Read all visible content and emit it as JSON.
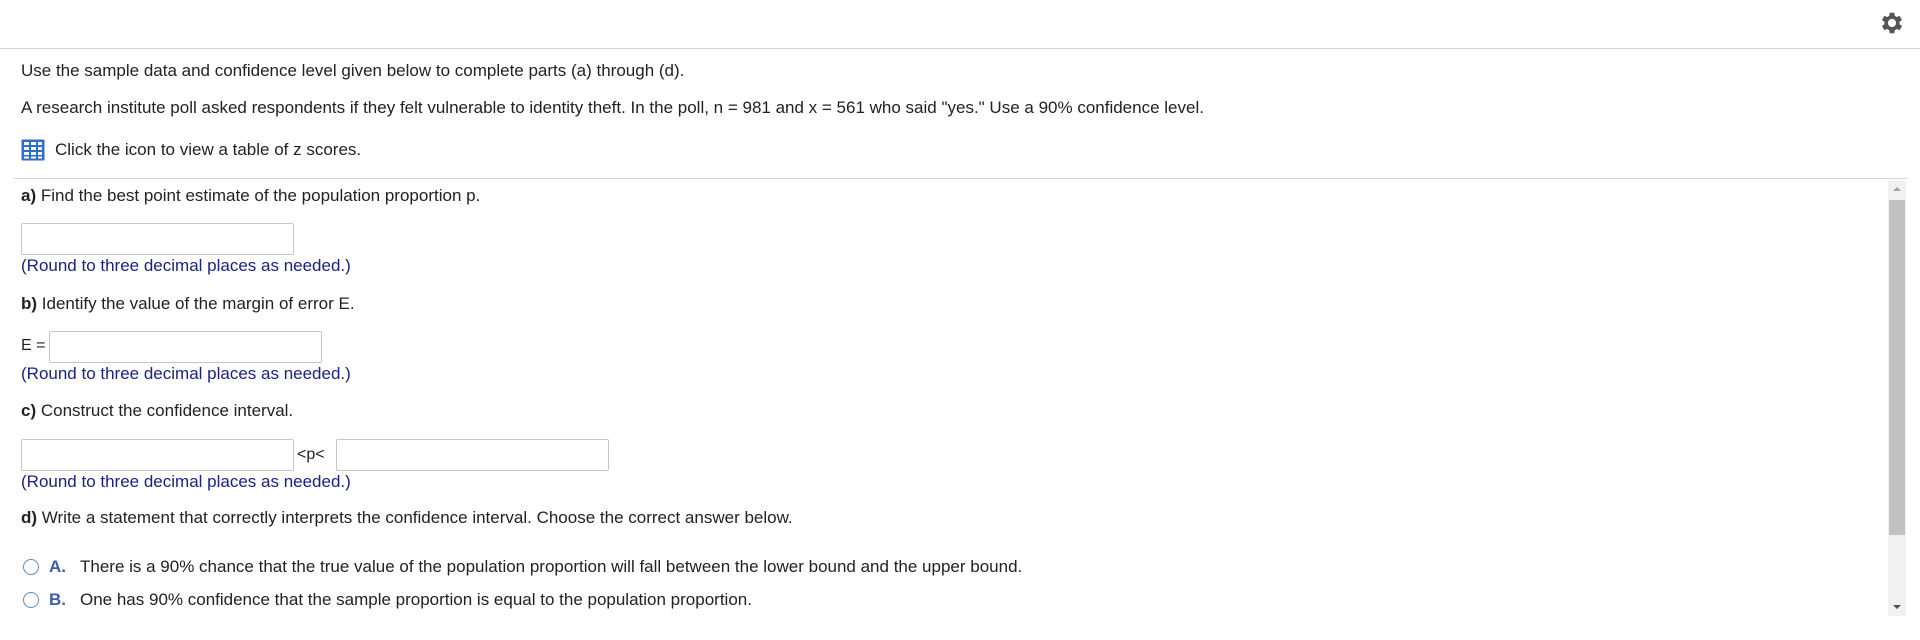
{
  "header": {
    "settings_icon": "gear-icon"
  },
  "intro": {
    "instruction": "Use the sample data and confidence level given below to complete parts (a) through (d).",
    "problem": "A research institute poll asked respondents if they felt vulnerable to identity theft. In the poll, n = 981 and x = 561 who said \"yes.\" Use a 90% confidence level.",
    "table_link_icon": "table-icon",
    "table_link_text": "Click the icon to view a table of z scores."
  },
  "parts": {
    "a": {
      "letter": "a)",
      "question": " Find the best point estimate of the population proportion p.",
      "input_value": "",
      "hint": "(Round to three decimal places as needed.)"
    },
    "b": {
      "letter": "b)",
      "question": " Identify the value of the margin of error E.",
      "label": "E =",
      "input_value": "",
      "hint": "(Round to three decimal places as needed.)"
    },
    "c": {
      "letter": "c)",
      "question": " Construct the confidence interval.",
      "lower_value": "",
      "middle_label": "<p<",
      "upper_value": "",
      "hint": "(Round to three decimal places as needed.)"
    },
    "d": {
      "letter": "d)",
      "question": " Write a statement that correctly interprets the confidence interval. Choose the correct answer below.",
      "options": [
        {
          "letter": "A.",
          "text": "There is a 90% chance that the true value of the population proportion will fall between the lower bound and the upper bound."
        },
        {
          "letter": "B.",
          "text": "One has 90% confidence that the sample proportion is equal to the population proportion."
        }
      ]
    }
  },
  "colors": {
    "hint": "#1a237e",
    "option_letter": "#3b5ea8",
    "table_icon": "#2f6fc9"
  }
}
